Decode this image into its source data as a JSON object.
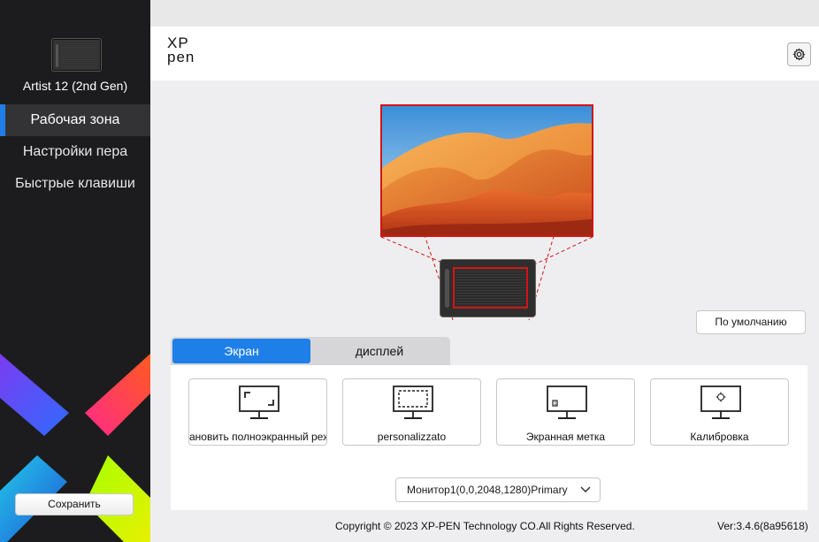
{
  "window": {
    "controls": [
      "close",
      "minimize"
    ]
  },
  "sidebar": {
    "device_name": "Artist 12 (2nd Gen)",
    "items": [
      {
        "label": "Рабочая зона",
        "active": true
      },
      {
        "label": "Настройки пера",
        "active": false
      },
      {
        "label": "Быстрые клавиши",
        "active": false
      }
    ],
    "save_label": "Сохранить"
  },
  "header": {
    "logo_line1": "XP",
    "logo_line2": "pen",
    "settings_icon": "gear-icon"
  },
  "workarea": {
    "default_label": "По умолчанию",
    "tabs": [
      {
        "label": "Экран",
        "active": true
      },
      {
        "label": "дисплей",
        "active": false
      }
    ],
    "cards": [
      {
        "label": "ановить полноэкранный реж",
        "icon": "fullscreen-icon"
      },
      {
        "label": "personalizzato",
        "icon": "custom-area-icon"
      },
      {
        "label": "Экранная метка",
        "icon": "screen-mark-icon"
      },
      {
        "label": "Калибровка",
        "icon": "calibration-icon"
      }
    ],
    "monitor_select": "Монитор1(0,0,2048,1280)Primary"
  },
  "footer": {
    "copyright": "Copyright © 2023  XP-PEN Technology CO.All Rights Reserved.",
    "version": "Ver:3.4.6(8a95618)"
  },
  "colors": {
    "accent": "#1e7fe8",
    "mapping_border": "#d21414",
    "sidebar_bg": "#1c1c1e"
  }
}
